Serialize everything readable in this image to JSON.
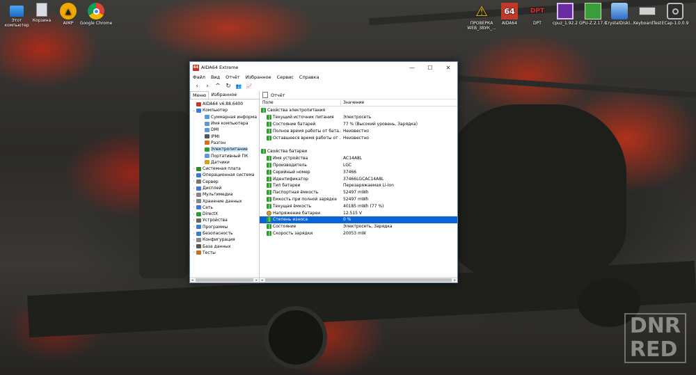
{
  "desktop_left": [
    {
      "label": "Этот компьютер",
      "icon": "computer-icon"
    },
    {
      "label": "Корзина",
      "icon": "recycle-bin-icon"
    },
    {
      "label": "AIMP",
      "icon": "aimp-icon"
    },
    {
      "label": "Google Chrome",
      "icon": "chrome-icon"
    }
  ],
  "desktop_right": [
    {
      "label": "ПРОВЕРКА WEB_ЗВУК_...",
      "icon": "warning-icon"
    },
    {
      "label": "AIDA64",
      "icon": "aida64-icon"
    },
    {
      "label": "DPT",
      "icon": "dpt-icon"
    },
    {
      "label": "cpuz_1.92.2",
      "icon": "cpuz-icon"
    },
    {
      "label": "GPU-Z.2.17.0",
      "icon": "gpuz-icon"
    },
    {
      "label": "CrystalDiskI...",
      "icon": "crystaldisk-icon"
    },
    {
      "label": "KeyboardTest",
      "icon": "keyboard-icon"
    },
    {
      "label": "ECap-1.0.0.9",
      "icon": "camera-icon"
    }
  ],
  "watermark": {
    "line1": "DNR",
    "line2": "RED"
  },
  "window": {
    "title": "AIDA64 Extreme",
    "app_icon_text": "64",
    "controls": {
      "minimize": "—",
      "maximize": "☐",
      "close": "✕"
    },
    "menu": [
      "Файл",
      "Вид",
      "Отчёт",
      "Избранное",
      "Сервис",
      "Справка"
    ],
    "toolbar": [
      "‹",
      "›",
      "^",
      "↻",
      "👥",
      "📈"
    ],
    "left_tabs": {
      "menu": "Меню",
      "favorites": "Избранное"
    },
    "report_label": "Отчёт",
    "tree": [
      {
        "label": "AIDA64 v6.88.6400",
        "level": 0,
        "exp": "",
        "color": "#c0392b"
      },
      {
        "label": "Компьютер",
        "level": 0,
        "exp": "⌄",
        "color": "#3a7bd5"
      },
      {
        "label": "Суммарная информа",
        "level": 1,
        "exp": "",
        "color": "#5a9ad8"
      },
      {
        "label": "Имя компьютера",
        "level": 1,
        "exp": "",
        "color": "#5a9ad8"
      },
      {
        "label": "DMI",
        "level": 1,
        "exp": "",
        "color": "#5a9ad8"
      },
      {
        "label": "IPMI",
        "level": 1,
        "exp": "",
        "color": "#555555"
      },
      {
        "label": "Разгон",
        "level": 1,
        "exp": "",
        "color": "#d07020"
      },
      {
        "label": "Электропитание",
        "level": 1,
        "exp": "",
        "color": "#2e9d2e",
        "selected": true
      },
      {
        "label": "Портативный ПК",
        "level": 1,
        "exp": "",
        "color": "#5a9ad8"
      },
      {
        "label": "Датчики",
        "level": 1,
        "exp": "",
        "color": "#d0a020"
      },
      {
        "label": "Системная плата",
        "level": 0,
        "exp": "›",
        "color": "#2e8a2e"
      },
      {
        "label": "Операционная система",
        "level": 0,
        "exp": "›",
        "color": "#3a7bd5"
      },
      {
        "label": "Сервер",
        "level": 0,
        "exp": "›",
        "color": "#777777"
      },
      {
        "label": "Дисплей",
        "level": 0,
        "exp": "›",
        "color": "#3a7bd5"
      },
      {
        "label": "Мультимедиа",
        "level": 0,
        "exp": "›",
        "color": "#888888"
      },
      {
        "label": "Хранение данных",
        "level": 0,
        "exp": "›",
        "color": "#888888"
      },
      {
        "label": "Сеть",
        "level": 0,
        "exp": "›",
        "color": "#3a7bd5"
      },
      {
        "label": "DirectX",
        "level": 0,
        "exp": "›",
        "color": "#2e9d2e"
      },
      {
        "label": "Устройства",
        "level": 0,
        "exp": "›",
        "color": "#666666"
      },
      {
        "label": "Программы",
        "level": 0,
        "exp": "›",
        "color": "#3a7bd5"
      },
      {
        "label": "Безопасность",
        "level": 0,
        "exp": "›",
        "color": "#3a7bd5"
      },
      {
        "label": "Конфигурация",
        "level": 0,
        "exp": "›",
        "color": "#888888"
      },
      {
        "label": "База данных",
        "level": 0,
        "exp": "›",
        "color": "#555555"
      },
      {
        "label": "Тесты",
        "level": 0,
        "exp": "›",
        "color": "#c07020"
      }
    ],
    "table": {
      "col_field": "Поле",
      "col_value": "Значение",
      "rows": [
        {
          "type": "section",
          "field": "Свойства электропитания",
          "value": ""
        },
        {
          "type": "item",
          "field": "Текущий источник питания",
          "value": "Электросеть"
        },
        {
          "type": "item",
          "field": "Состояние батарей",
          "value": "77 % (Высокий уровень, Зарядка)"
        },
        {
          "type": "item",
          "field": "Полное время работы от бата...",
          "value": "Неизвестно"
        },
        {
          "type": "item",
          "field": "Оставшееся время работы от ...",
          "value": "Неизвестно"
        },
        {
          "type": "gap"
        },
        {
          "type": "section",
          "field": "Свойства батареи",
          "value": ""
        },
        {
          "type": "item",
          "field": "Имя устройства",
          "value": "AC14A8L"
        },
        {
          "type": "item",
          "field": "Производитель",
          "value": "LGC"
        },
        {
          "type": "item",
          "field": "Серийный номер",
          "value": "37466"
        },
        {
          "type": "item",
          "field": "Идентификатор",
          "value": "37466LGCAC14A8L"
        },
        {
          "type": "item",
          "field": "Тип батареи",
          "value": "Перезаряжаемая Li-Ion"
        },
        {
          "type": "item",
          "field": "Паспортная ёмкость",
          "value": "52497 mWh"
        },
        {
          "type": "item",
          "field": "Ёмкость при полной зарядке",
          "value": "52497 mWh"
        },
        {
          "type": "item",
          "field": "Текущая ёмкость",
          "value": "40185 mWh  (77 %)"
        },
        {
          "type": "item",
          "field": "Напряжение батареи",
          "value": "12.515 V",
          "icon": "gear"
        },
        {
          "type": "item",
          "field": "Степень износа",
          "value": "0 %",
          "selected": true
        },
        {
          "type": "item",
          "field": "Состояние",
          "value": "Электросеть, Зарядка"
        },
        {
          "type": "item",
          "field": "Скорость зарядки",
          "value": "20053 mW"
        }
      ]
    },
    "scroll_arrows": {
      "left": "◂",
      "right": "▸"
    }
  }
}
